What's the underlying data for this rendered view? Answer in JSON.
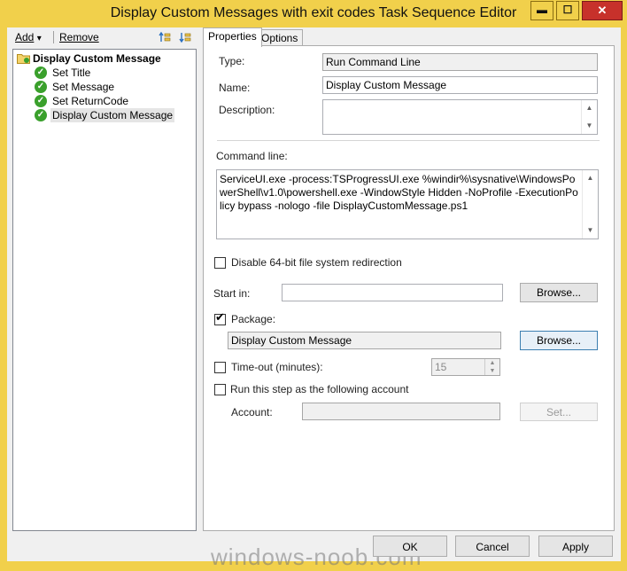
{
  "window": {
    "title": "Display Custom Messages with exit codes Task Sequence Editor",
    "min_glyph": "▬",
    "max_glyph": "☐",
    "close_glyph": "✕"
  },
  "toolbar": {
    "add_label": "Add",
    "add_arrow": "▾",
    "remove_label": "Remove"
  },
  "tree": {
    "root_label": "Display Custom Message",
    "items": [
      {
        "label": "Set Title"
      },
      {
        "label": "Set Message"
      },
      {
        "label": "Set ReturnCode"
      },
      {
        "label": "Display Custom Message"
      }
    ],
    "check_glyph": "✓"
  },
  "tabs": {
    "properties": "Properties",
    "options": "Options"
  },
  "form": {
    "type_label": "Type:",
    "type_value": "Run Command Line",
    "name_label": "Name:",
    "name_value": "Display Custom Message",
    "description_label": "Description:",
    "description_value": "",
    "command_label": "Command line:",
    "command_value": "ServiceUI.exe -process:TSProgressUI.exe %windir%\\sysnative\\WindowsPowerShell\\v1.0\\powershell.exe -WindowStyle Hidden -NoProfile -ExecutionPolicy bypass -nologo -file DisplayCustomMessage.ps1",
    "disable64_label": "Disable 64-bit file system redirection",
    "startin_label": "Start in:",
    "startin_value": "",
    "browse_label": "Browse...",
    "package_label": "Package:",
    "package_value": "Display Custom Message",
    "timeout_label": "Time-out (minutes):",
    "timeout_value": "15",
    "runas_label": "Run this step as the following account",
    "account_label": "Account:",
    "account_value": "",
    "set_label": "Set..."
  },
  "footer": {
    "ok_label": "OK",
    "cancel_label": "Cancel",
    "apply_label": "Apply",
    "watermark": "windows-noob.com"
  },
  "colors": {
    "frame": "#f1d04b",
    "close_button": "#c7312b",
    "check_icon": "#3aa02c"
  }
}
